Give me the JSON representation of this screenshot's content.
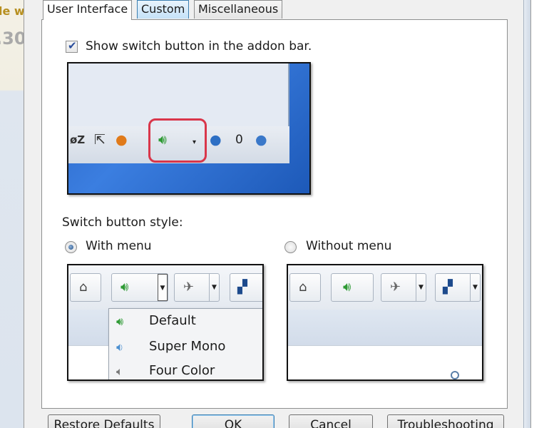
{
  "background": {
    "fragment_top": "le w",
    "fragment_number": ".30"
  },
  "tabs": [
    {
      "label": "User Interface",
      "active": true
    },
    {
      "label": "Custom",
      "active": false
    },
    {
      "label": "Miscellaneous",
      "active": false
    }
  ],
  "addon_option": {
    "label": "Show switch button in the addon bar.",
    "checked": true,
    "preview_counter": "0"
  },
  "style_section": {
    "label": "Switch button style:",
    "options": [
      {
        "label": "With menu",
        "selected": true
      },
      {
        "label": "Without menu",
        "selected": false
      }
    ],
    "menu_items": [
      {
        "label": "Default",
        "icon": "speaker-icon"
      },
      {
        "label": "Super Mono",
        "icon": "mono-speaker-icon"
      },
      {
        "label": "Four Color",
        "icon": "four-color-speaker-icon"
      }
    ]
  },
  "buttons": {
    "restore": "Restore Defaults",
    "ok": "OK",
    "cancel": "Cancel",
    "troubleshooting": "Troubleshooting"
  },
  "colors": {
    "accent_green": "#2e9a34",
    "highlight_red": "#d9364a",
    "selection_blue": "#3c7fb1"
  }
}
